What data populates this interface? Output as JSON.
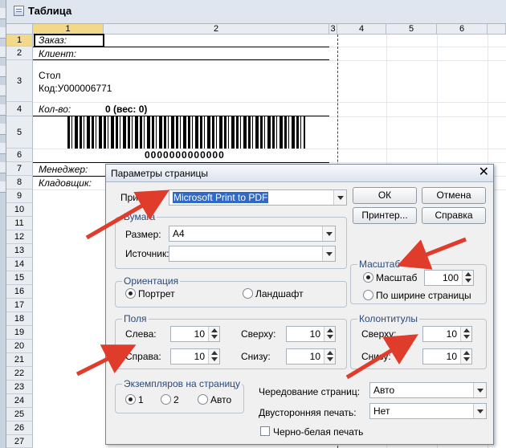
{
  "window": {
    "title": "Таблица"
  },
  "grid": {
    "columns": [
      "1",
      "2",
      "3",
      "4",
      "5",
      "6"
    ],
    "rows": [
      "1",
      "2",
      "3",
      "4",
      "5",
      "6",
      "7",
      "8",
      "9",
      "10",
      "11",
      "12",
      "13",
      "14",
      "15",
      "16",
      "17",
      "18",
      "19",
      "20",
      "21",
      "22",
      "23",
      "24",
      "25",
      "26",
      "27"
    ]
  },
  "doc": {
    "order_label": "Заказ:",
    "client_label": "Клиент:",
    "item_name": "Стол",
    "item_code": "Код:У000006771",
    "qty_label": "Кол-во:",
    "qty_value": "0 (вес: 0)",
    "barcode_number": "0000000000000",
    "manager_label": "Менеджер:",
    "storekeeper_label": "Кладовщик:"
  },
  "dialog": {
    "title": "Параметры страницы",
    "printer_label": "Принтер:",
    "printer_value": "Microsoft Print to PDF",
    "ok_label": "ОК",
    "cancel_label": "Отмена",
    "printer_button_label": "Принтер...",
    "help_label": "Справка",
    "paper_group": "Бумага",
    "size_label": "Размер:",
    "size_value": "А4",
    "source_label": "Источник:",
    "source_value": "",
    "orientation_group": "Ориентация",
    "portrait_label": "Портрет",
    "landscape_label": "Ландшафт",
    "scale_group": "Масштаб",
    "scale_label": "Масштаб",
    "scale_value": "100",
    "fit_width_label": "По ширине страницы",
    "margins_group": "Поля",
    "left_label": "Слева:",
    "left_value": "10",
    "right_label": "Справа:",
    "right_value": "10",
    "top_label": "Сверху:",
    "top_value": "10",
    "bottom_label": "Снизу:",
    "bottom_value": "10",
    "hf_group": "Колонтитулы",
    "hf_top_label": "Сверху:",
    "hf_top_value": "10",
    "hf_bottom_label": "Снизу:",
    "hf_bottom_value": "10",
    "copies_group": "Экземпляров на страницу",
    "copies_1": "1",
    "copies_2": "2",
    "copies_auto": "Авто",
    "alternation_label": "Чередование страниц:",
    "alternation_value": "Авто",
    "duplex_label": "Двусторонняя печать:",
    "duplex_value": "Нет",
    "bw_label": "Черно-белая печать"
  },
  "colors": {
    "accent": "#316ac5",
    "arrow": "#e03c2c",
    "group_title": "#2a4a7b"
  }
}
